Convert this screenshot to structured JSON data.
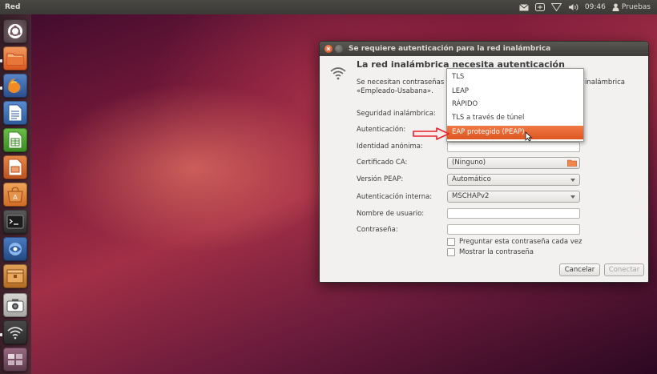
{
  "panel": {
    "title": "Red",
    "clock": "09:46",
    "user": "Pruebas"
  },
  "launcher": {
    "items": [
      {
        "name": "dash",
        "icon": "ubuntu-logo-icon"
      },
      {
        "name": "files",
        "icon": "folder-icon"
      },
      {
        "name": "firefox",
        "icon": "firefox-icon"
      },
      {
        "name": "writer",
        "icon": "writer-document-icon"
      },
      {
        "name": "calc",
        "icon": "calc-spreadsheet-icon"
      },
      {
        "name": "impress",
        "icon": "impress-presentation-icon"
      },
      {
        "name": "software-center",
        "icon": "software-center-icon"
      },
      {
        "name": "terminal",
        "icon": "terminal-icon"
      },
      {
        "name": "network",
        "icon": "network-icon"
      },
      {
        "name": "archive",
        "icon": "archive-icon"
      },
      {
        "name": "camera",
        "icon": "camera-icon"
      },
      {
        "name": "wifi",
        "icon": "wifi-icon"
      },
      {
        "name": "workspaces",
        "icon": "workspaces-icon"
      }
    ]
  },
  "dialog": {
    "title": "Se requiere autenticación para la red inalámbrica",
    "heading": "La red inalámbrica necesita autenticación",
    "desc_line1": "Se necesitan contraseñas",
    "desc_line1_end": "l inalámbrica",
    "desc_line2": "«Empleado-Usabana».",
    "labels": {
      "security": "Seguridad inalámbrica:",
      "authentication": "Autenticación:",
      "anonymous_identity": "Identidad anónima:",
      "ca_certificate": "Certificado CA:",
      "peap_version": "Versión PEAP:",
      "inner_auth": "Autenticación interna:",
      "username": "Nombre de usuario:",
      "password": "Contraseña:"
    },
    "ca_certificate_value": "(Ninguno)",
    "peap_version_value": "Automático",
    "inner_auth_value": "MSCHAPv2",
    "checkboxes": {
      "ask_password": "Preguntar esta contraseña cada vez",
      "show_password": "Mostrar la contraseña"
    },
    "buttons": {
      "cancel": "Cancelar",
      "connect": "Conectar"
    }
  },
  "menu": {
    "items": [
      "TLS",
      "LEAP",
      "RÁPIDO",
      "TLS a través de túnel",
      "EAP protegido (PEAP)"
    ],
    "selected_index": 4
  },
  "colors": {
    "accent": "#dd5520",
    "arrow": "#e8202a"
  }
}
